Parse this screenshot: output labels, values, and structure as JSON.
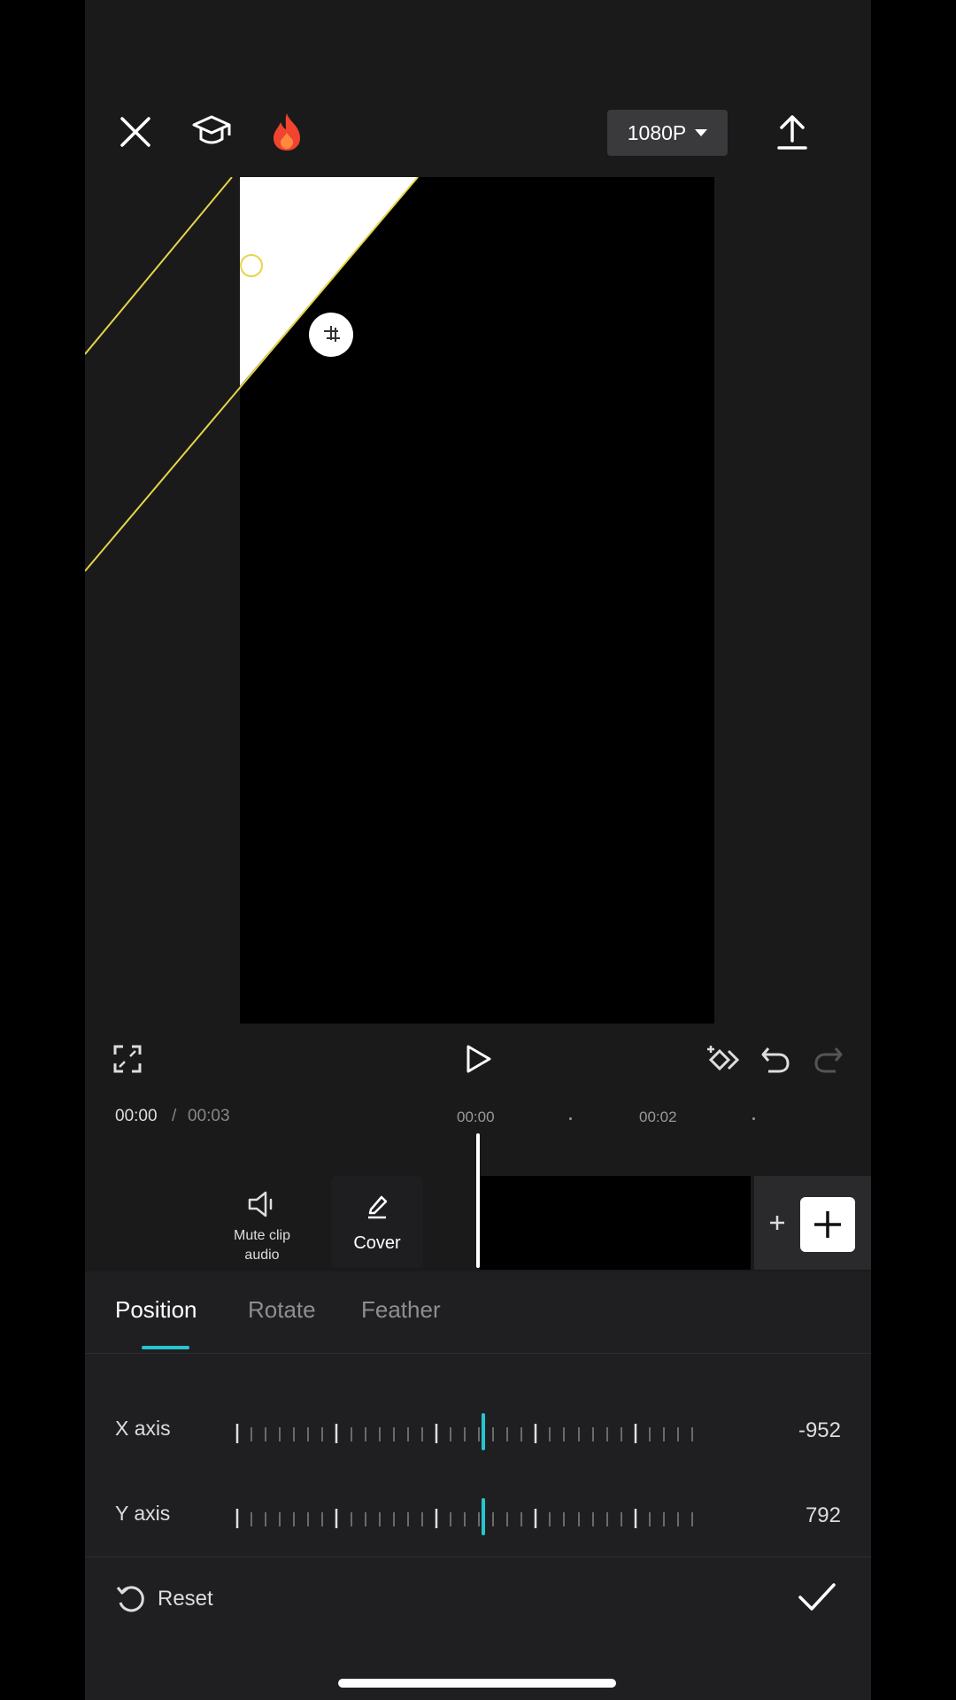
{
  "toolbar": {
    "close_icon": "close-icon",
    "tutorial_icon": "graduation-cap-icon",
    "trending_icon": "flame-icon",
    "resolution_label": "1080P",
    "export_icon": "upload-icon"
  },
  "playback": {
    "fullscreen_icon": "fullscreen-icon",
    "play_icon": "play-icon",
    "keyframe_icon": "keyframe-icon",
    "undo_icon": "undo-icon",
    "redo_icon": "redo-icon"
  },
  "timeline": {
    "current_time": "00:00",
    "separator": "/",
    "total_time": "00:03",
    "ruler": [
      "00:00",
      "00:02"
    ],
    "mute_label": "Mute clip audio",
    "cover_label": "Cover"
  },
  "panel": {
    "tabs": [
      "Position",
      "Rotate",
      "Feather"
    ],
    "active_tab": "Position",
    "x_axis": {
      "label": "X axis",
      "value": "-952"
    },
    "y_axis": {
      "label": "Y axis",
      "value": "792"
    },
    "reset_label": "Reset"
  },
  "colors": {
    "accent": "#27c4cf",
    "mask_line": "#e6d44a",
    "background": "#1a1a1b"
  }
}
